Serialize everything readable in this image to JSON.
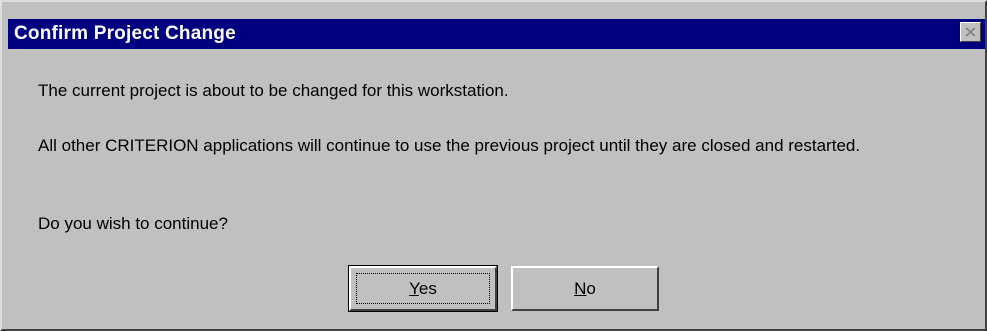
{
  "dialog": {
    "title": "Confirm Project Change",
    "message_line1": "The current project is about to be changed for this workstation.",
    "message_line2": "All other CRITERION applications will continue to use the previous project until they are closed and restarted.",
    "message_line3": "Do you wish to continue?",
    "buttons": {
      "yes_mnemonic": "Y",
      "yes_rest": "es",
      "no_mnemonic": "N",
      "no_rest": "o"
    }
  },
  "colors": {
    "titlebar": "#000080",
    "face": "#c0c0c0"
  },
  "icons": {
    "close": "close-icon"
  }
}
